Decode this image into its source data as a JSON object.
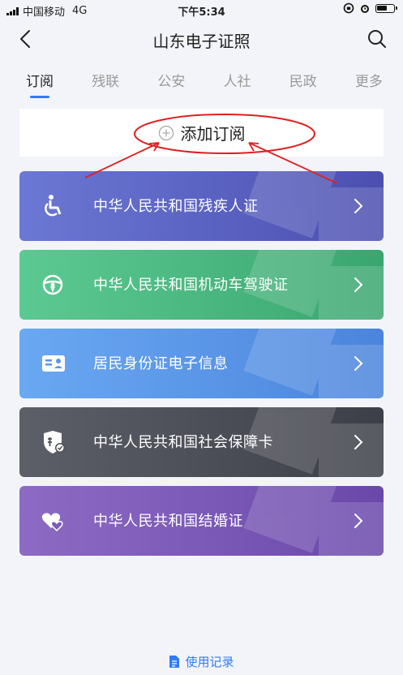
{
  "status": {
    "carrier": "中国移动",
    "network": "4G",
    "time": "下午5:34"
  },
  "header": {
    "title": "山东电子证照"
  },
  "tabs": [
    {
      "label": "订阅",
      "active": true
    },
    {
      "label": "残联"
    },
    {
      "label": "公安"
    },
    {
      "label": "人社"
    },
    {
      "label": "民政"
    },
    {
      "label": "更多"
    }
  ],
  "add": {
    "label": "添加订阅",
    "icon": "plus-circle-icon"
  },
  "cards": [
    {
      "label": "中华人民共和国残疾人证",
      "icon": "wheelchair-icon",
      "color_from": "#6b78d4",
      "color_to": "#4c4fb0"
    },
    {
      "label": "中华人民共和国机动车驾驶证",
      "icon": "steering-wheel-icon",
      "color_from": "#5cc992",
      "color_to": "#3aa66f"
    },
    {
      "label": "居民身份证电子信息",
      "icon": "id-card-icon",
      "color_from": "#6aa8f2",
      "color_to": "#4b84dc"
    },
    {
      "label": "中华人民共和国社会保障卡",
      "icon": "social-security-shield-icon",
      "color_from": "#5d5f68",
      "color_to": "#3d3f48"
    },
    {
      "label": "中华人民共和国结婚证",
      "icon": "hearts-icon",
      "color_from": "#8d6bc4",
      "color_to": "#6a48aa"
    }
  ],
  "footer": {
    "label": "使用记录",
    "icon": "document-icon"
  }
}
